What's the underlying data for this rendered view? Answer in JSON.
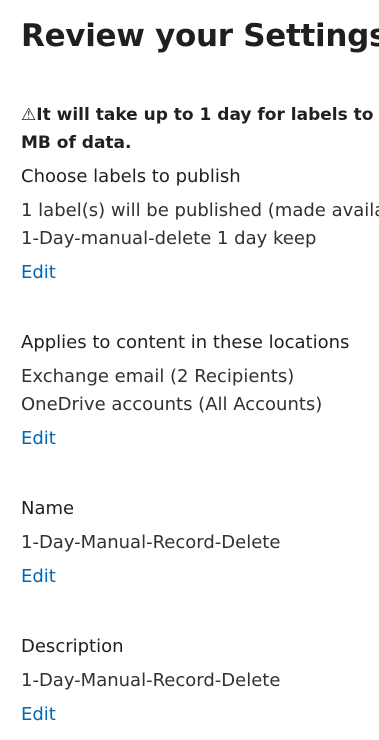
{
  "page": {
    "title": "Review your Settings",
    "warning_icon": "⚠",
    "warning_line1": "It will take up to 1 day for labels to",
    "warning_line2": "MB of data."
  },
  "sections": [
    {
      "heading": "Choose labels to publish",
      "lines": [
        "1 label(s) will be published (made availa",
        "1-Day-manual-delete 1 day keep"
      ],
      "edit": "Edit"
    },
    {
      "heading": "Applies to content in these locations",
      "lines": [
        "Exchange email (2 Recipients)",
        "OneDrive accounts (All Accounts)"
      ],
      "edit": "Edit"
    },
    {
      "heading": "Name",
      "lines": [
        "1-Day-Manual-Record-Delete"
      ],
      "edit": "Edit"
    },
    {
      "heading": "Description",
      "lines": [
        "1-Day-Manual-Record-Delete"
      ],
      "edit": "Edit"
    }
  ]
}
